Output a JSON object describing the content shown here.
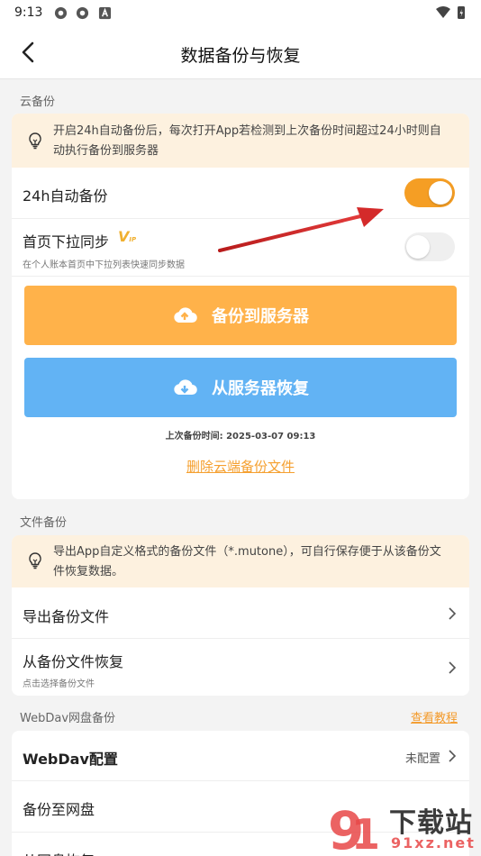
{
  "status_bar": {
    "time": "9:13"
  },
  "header": {
    "title": "数据备份与恢复"
  },
  "cloud": {
    "section_label": "云备份",
    "tip": "开启24h自动备份后，每次打开App若检测到上次备份时间超过24小时则自动执行备份到服务器",
    "auto_backup": {
      "label": "24h自动备份",
      "enabled": true
    },
    "pull_sync": {
      "label": "首页下拉同步",
      "badge": "V",
      "badge_small": "IP",
      "subtitle": "在个人账本首页中下拉列表快速同步数据",
      "enabled": false
    },
    "backup_button": "备份到服务器",
    "restore_button": "从服务器恢复",
    "last_backup": "上次备份时间: 2025-03-07 09:13",
    "delete_link": "删除云端备份文件"
  },
  "file": {
    "section_label": "文件备份",
    "tip": "导出App自定义格式的备份文件（*.mutone），可自行保存便于从该备份文件恢复数据。",
    "export_label": "导出备份文件",
    "restore_label": "从备份文件恢复",
    "restore_sub": "点击选择备份文件"
  },
  "webdav": {
    "section_label": "WebDav网盘备份",
    "tutorial_link": "查看教程",
    "config_label": "WebDav配置",
    "config_value": "未配置",
    "backup_label": "备份至网盘",
    "restore_label": "从网盘恢复"
  },
  "watermark": {
    "brand": "下载站",
    "site": "91xz.net"
  },
  "colors": {
    "accent": "#f59e24",
    "blue": "#62b3f4",
    "tip_bg": "#fdf1df",
    "link": "#f5a030",
    "annotation_arrow": "#d42a2a"
  }
}
